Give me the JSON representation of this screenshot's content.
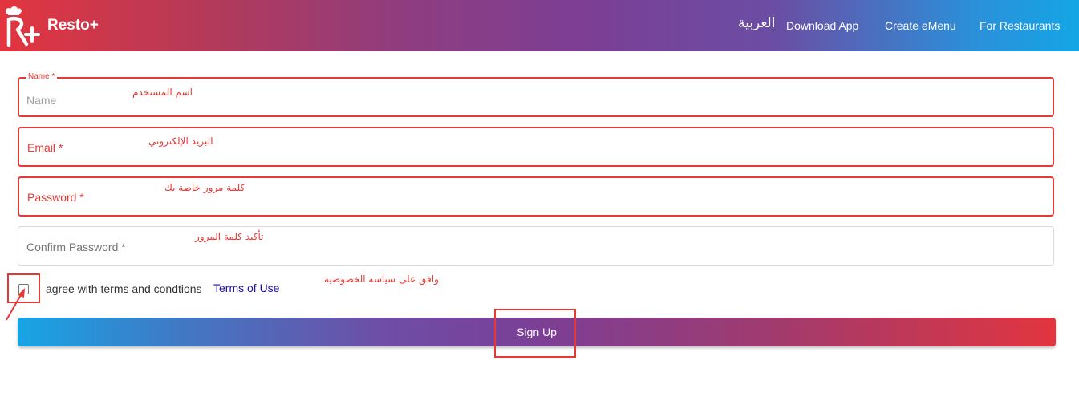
{
  "header": {
    "brand": "Resto+",
    "logo_letter": "R",
    "nav": {
      "arabic": "العربية",
      "download_app": "Download App",
      "create_emenu": "Create eMenu",
      "for_restaurants": "For Restaurants"
    },
    "colors": {
      "start": "#e2353f",
      "mid": "#7b3f96",
      "end": "#14a6e6"
    }
  },
  "form": {
    "name": {
      "legend": "Name *",
      "placeholder": "Name",
      "value": "",
      "annotation": "اسم المستخدم"
    },
    "email": {
      "label": "Email *",
      "value": "",
      "annotation": "البريد الإلكتروني"
    },
    "password": {
      "label": "Password *",
      "value": "",
      "annotation": "كلمة مرور خاصة بك"
    },
    "confirm_password": {
      "label": "Confirm Password *",
      "value": "",
      "annotation": "تأكيد كلمة المرور"
    },
    "terms": {
      "agree_text": "agree with terms and condtions",
      "link_text": "Terms of Use",
      "checked": false,
      "annotation": "وافق على سياسة الخصوصية"
    },
    "submit_label": "Sign Up",
    "error_color": "#e53935"
  }
}
